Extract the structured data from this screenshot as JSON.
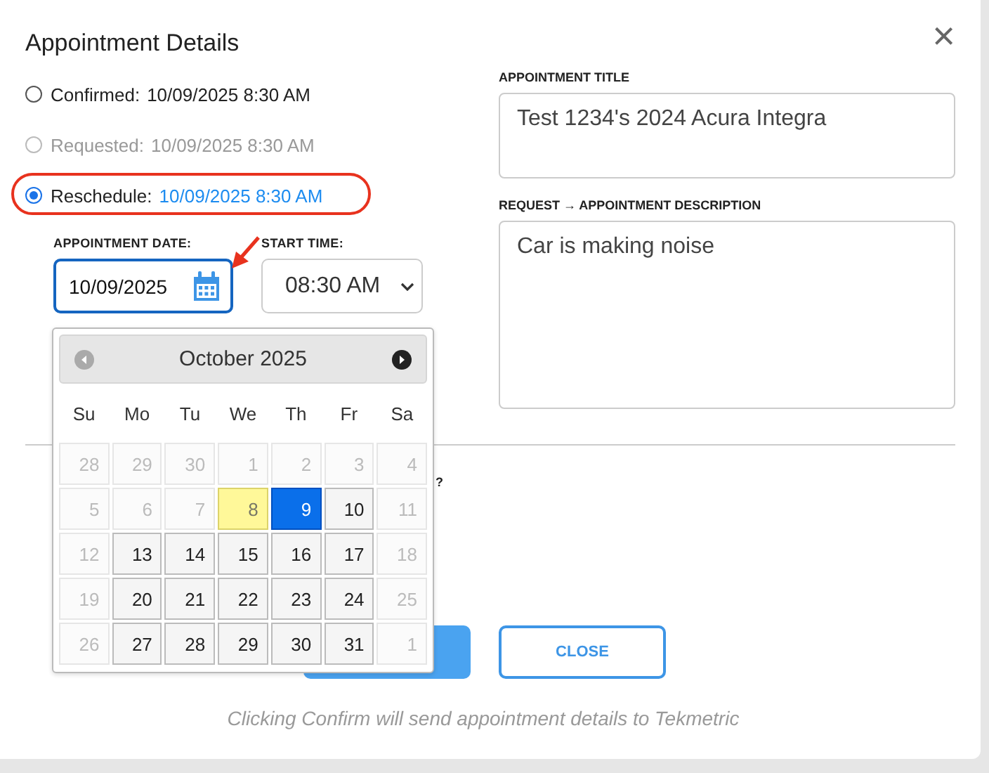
{
  "dialog": {
    "title": "Appointment Details",
    "close": "×"
  },
  "options": [
    {
      "label": "Confirmed:",
      "value": "10/09/2025 8:30 AM",
      "selected": false,
      "disabled": false,
      "circled": false
    },
    {
      "label": "Requested:",
      "value": "10/09/2025 8:30 AM",
      "selected": false,
      "disabled": true,
      "circled": false
    },
    {
      "label": "Reschedule:",
      "value": "10/09/2025 8:30 AM",
      "selected": true,
      "disabled": false,
      "circled": true
    }
  ],
  "date_field": {
    "label": "APPOINTMENT DATE:",
    "value": "10/09/2025",
    "focused": true
  },
  "time_field": {
    "label": "START TIME:",
    "value": "08:30 AM"
  },
  "calendar": {
    "month": "October 2025",
    "prev_disabled": true,
    "weekdays": [
      "Su",
      "Mo",
      "Tu",
      "We",
      "Th",
      "Fr",
      "Sa"
    ],
    "days": [
      {
        "label": "28",
        "kind": "muted",
        "selected": false
      },
      {
        "label": "29",
        "kind": "muted",
        "selected": false
      },
      {
        "label": "30",
        "kind": "muted",
        "selected": false
      },
      {
        "label": "1",
        "kind": "muted",
        "selected": false
      },
      {
        "label": "2",
        "kind": "muted",
        "selected": false
      },
      {
        "label": "3",
        "kind": "muted",
        "selected": false
      },
      {
        "label": "4",
        "kind": "muted",
        "selected": false
      },
      {
        "label": "5",
        "kind": "muted",
        "selected": false
      },
      {
        "label": "6",
        "kind": "muted",
        "selected": false
      },
      {
        "label": "7",
        "kind": "muted",
        "selected": false
      },
      {
        "label": "8",
        "kind": "today",
        "selected": false
      },
      {
        "label": "9",
        "kind": "normal",
        "selected": true
      },
      {
        "label": "10",
        "kind": "normal",
        "selected": false
      },
      {
        "label": "11",
        "kind": "muted",
        "selected": false
      },
      {
        "label": "12",
        "kind": "muted",
        "selected": false
      },
      {
        "label": "13",
        "kind": "normal",
        "selected": false
      },
      {
        "label": "14",
        "kind": "normal",
        "selected": false
      },
      {
        "label": "15",
        "kind": "normal",
        "selected": false
      },
      {
        "label": "16",
        "kind": "normal",
        "selected": false
      },
      {
        "label": "17",
        "kind": "normal",
        "selected": false
      },
      {
        "label": "18",
        "kind": "muted",
        "selected": false
      },
      {
        "label": "19",
        "kind": "muted",
        "selected": false
      },
      {
        "label": "20",
        "kind": "normal",
        "selected": false
      },
      {
        "label": "21",
        "kind": "normal",
        "selected": false
      },
      {
        "label": "22",
        "kind": "normal",
        "selected": false
      },
      {
        "label": "23",
        "kind": "normal",
        "selected": false
      },
      {
        "label": "24",
        "kind": "normal",
        "selected": false
      },
      {
        "label": "25",
        "kind": "muted",
        "selected": false
      },
      {
        "label": "26",
        "kind": "muted",
        "selected": false
      },
      {
        "label": "27",
        "kind": "normal",
        "selected": false
      },
      {
        "label": "28",
        "kind": "normal",
        "selected": false
      },
      {
        "label": "29",
        "kind": "normal",
        "selected": false
      },
      {
        "label": "30",
        "kind": "normal",
        "selected": false
      },
      {
        "label": "31",
        "kind": "normal",
        "selected": false
      },
      {
        "label": "1",
        "kind": "muted",
        "selected": false
      }
    ]
  },
  "title_field": {
    "label": "APPOINTMENT TITLE",
    "value": "Test 1234's 2024 Acura Integra"
  },
  "description_field": {
    "label": "REQUEST → APPOINTMENT DESCRIPTION",
    "value": "Car is making noise"
  },
  "hidden_label_tail": "?",
  "buttons": [
    {
      "kind": "primary"
    },
    {
      "kind": "outline",
      "label": "CLOSE"
    }
  ],
  "footnote": "Clicking Confirm will send appointment details to Tekmetric"
}
